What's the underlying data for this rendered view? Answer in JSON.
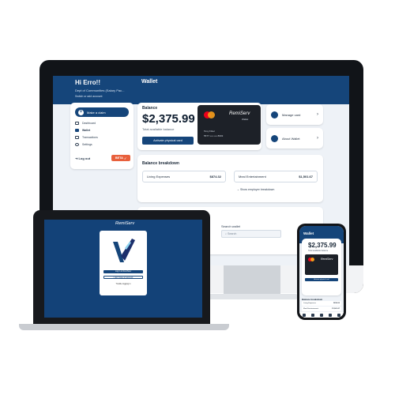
{
  "desktop": {
    "greeting": "Hi Erro!!",
    "department": "Dept of Communities (Salary Pac...",
    "switch_account": "Switch or add account",
    "page_title": "Wallet",
    "sidebar": {
      "make_claim": "Make a claim",
      "items": [
        {
          "label": "Dashboard",
          "icon": "home-icon"
        },
        {
          "label": "Wallet",
          "icon": "wallet-icon"
        },
        {
          "label": "Transactions",
          "icon": "transactions-icon"
        },
        {
          "label": "Settings",
          "icon": "gear-icon"
        }
      ],
      "logout": "Log out",
      "beta": "BETA"
    },
    "balance": {
      "label": "Balance",
      "amount": "$2,375.99",
      "subtitle": "Total available balance",
      "activate_button": "Activate physical card"
    },
    "card": {
      "brand": "RemiServ",
      "brand_sub": "Wallet",
      "holder": "Tony Fitter",
      "number": "5577 •••• •••• 8693"
    },
    "side_actions": [
      {
        "label": "Manage card"
      },
      {
        "label": "About Wallet"
      }
    ],
    "breakdown": {
      "title": "Balance breakdown",
      "items": [
        {
          "label": "Living Expenses",
          "value": "$874.32"
        },
        {
          "label": "Meal Entertainment",
          "value": "$1,501.67"
        }
      ],
      "show_link": "Show employer breakdown"
    }
  },
  "laptop": {
    "brand": "RemiServ",
    "login_button": "Log in to RemiServ",
    "create_button": "I don't have an account",
    "link": "Trouble logging in"
  },
  "search": {
    "label": "Search wallet",
    "placeholder": "Search"
  },
  "phone": {
    "title": "Wallet",
    "amount": "$2,375.99",
    "subtitle": "Total available balance",
    "activate": "Activate physical card",
    "breakdown_title": "Balance breakdown",
    "items": [
      {
        "label": "Living Expenses",
        "value": "$874.32"
      },
      {
        "label": "Meal Entertainment",
        "value": "$1,501.67"
      }
    ],
    "card_brand": "RemiServ"
  },
  "colors": {
    "brand_blue": "#15457a",
    "beta_orange": "#e8603c",
    "card_dark": "#1d2128"
  }
}
